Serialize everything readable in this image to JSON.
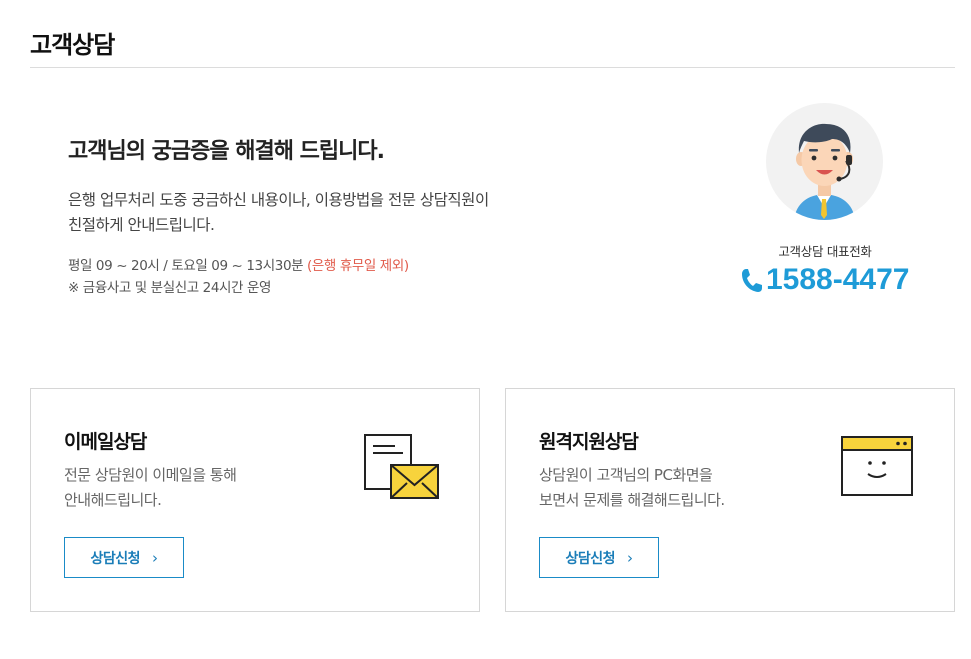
{
  "page": {
    "title": "고객상담"
  },
  "hero": {
    "heading": "고객님의 궁금증을 해결해 드립니다.",
    "desc_line1": "은행 업무처리 도중 궁금하신 내용이나, 이용방법을 전문 상담직원이",
    "desc_line2": "친절하게 안내드립니다.",
    "hours": "평일 09 ~ 20시 / 토요일 09 ~ 13시30분 ",
    "hours_note": "(은행 휴무일 제외)",
    "notice": "※ 금융사고 및 분실신고 24시간 운영"
  },
  "contact": {
    "label": "고객상담 대표전화",
    "phone": "1588-4477",
    "icon": "phone-icon",
    "color": "#1e9bd7"
  },
  "cards": [
    {
      "title": "이메일상담",
      "desc_line1": "전문 상담원이 이메일을 통해",
      "desc_line2": "안내해드립니다.",
      "button": "상담신청",
      "icon": "email-icon"
    },
    {
      "title": "원격지원상담",
      "desc_line1": "상담원이 고객님의 PC화면을",
      "desc_line2": "보면서 문제를 해결해드립니다.",
      "button": "상담신청",
      "icon": "remote-screen-icon"
    }
  ],
  "colors": {
    "accent": "#1e9bd7",
    "highlight": "#f7d33c",
    "note": "#e15b4b"
  }
}
